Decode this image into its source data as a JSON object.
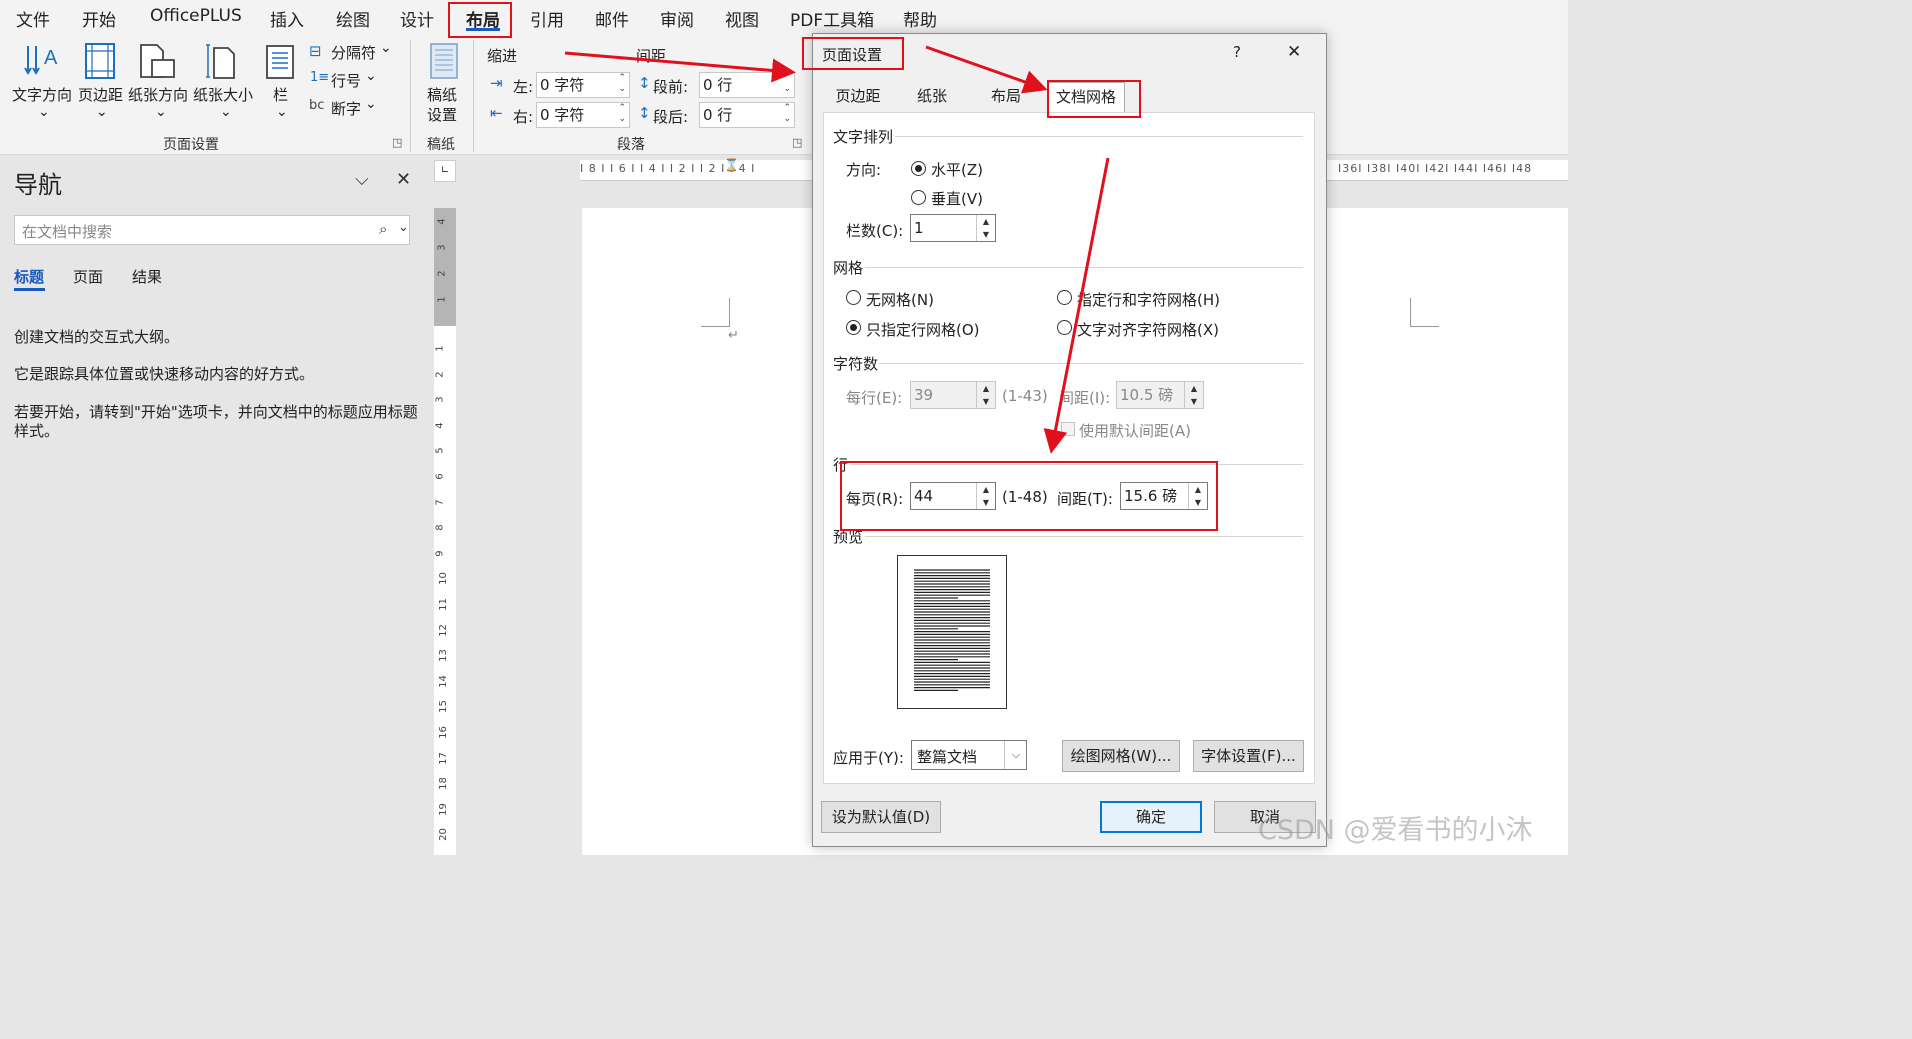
{
  "menubar": {
    "items": [
      "文件",
      "开始",
      "OfficePLUS",
      "插入",
      "绘图",
      "设计",
      "布局",
      "引用",
      "邮件",
      "审阅",
      "视图",
      "PDF工具箱",
      "帮助"
    ],
    "active": "布局"
  },
  "ribbon": {
    "page_setup": {
      "text_direction": "文字方向",
      "margins": "页边距",
      "orientation": "纸张方向",
      "size": "纸张大小",
      "columns": "栏",
      "breaks": "分隔符",
      "line_numbers": "行号",
      "hyphenation": "断字",
      "group_label": "页面设置"
    },
    "manuscript": {
      "button_line1": "稿纸",
      "button_line2": "设置",
      "group_label": "稿纸"
    },
    "paragraph": {
      "indent_header": "缩进",
      "spacing_header": "间距",
      "left_label": "左:",
      "left_value": "0 字符",
      "right_label": "右:",
      "right_value": "0 字符",
      "before_label": "段前:",
      "before_value": "0 行",
      "after_label": "段后:",
      "after_value": "0 行",
      "group_label": "段落"
    }
  },
  "nav": {
    "title": "导航",
    "search_placeholder": "在文档中搜索",
    "tabs": [
      "标题",
      "页面",
      "结果"
    ],
    "p1": "创建文档的交互式大纲。",
    "p2": "它是跟踪具体位置或快速移动内容的好方式。",
    "p3_line1": "若要开始，请转到\"开始\"选项卡，并向文档中的标题应用标题",
    "p3_line2": "样式。"
  },
  "ruler": {
    "h_left": "I 8 I  I 6 I  I 4 I  I 2 I     I 2 I  I 4 I",
    "h_right": "I36I  I38I  I40I  I42I  I44I  I46I  I48",
    "v_top": [
      "4",
      "3",
      "2",
      "1"
    ],
    "v_main": [
      "1",
      "2",
      "3",
      "4",
      "5",
      "6",
      "7",
      "8",
      "9",
      "10",
      "11",
      "12",
      "13",
      "14",
      "15",
      "16",
      "17",
      "18",
      "19",
      "20"
    ]
  },
  "dialog": {
    "title": "页面设置",
    "help": "?",
    "close": "✕",
    "tabs": [
      "页边距",
      "纸张",
      "布局",
      "文档网格"
    ],
    "selected_tab": "文档网格",
    "text_layout_header": "文字排列",
    "direction_label": "方向:",
    "dir_horizontal": "水平(Z)",
    "dir_vertical": "垂直(V)",
    "columns_label": "栏数(C):",
    "columns_value": "1",
    "grid_header": "网格",
    "grid_none": "无网格(N)",
    "grid_line_char": "指定行和字符网格(H)",
    "grid_line_only": "只指定行网格(O)",
    "grid_snap_char": "文字对齐字符网格(X)",
    "chars_header": "字符数",
    "per_line_label": "每行(E):",
    "per_line_value": "39",
    "per_line_range": "(1-43)",
    "char_pitch_label": "间距(I):",
    "char_pitch_value": "10.5 磅",
    "use_default_pitch": "使用默认间距(A)",
    "lines_header": "行",
    "per_page_label": "每页(R):",
    "per_page_value": "44",
    "per_page_range": "(1-48)",
    "line_pitch_label": "间距(T):",
    "line_pitch_value": "15.6 磅",
    "preview_header": "预览",
    "apply_label": "应用于(Y):",
    "apply_value": "整篇文档",
    "draw_grid_btn": "绘图网格(W)...",
    "font_settings_btn": "字体设置(F)...",
    "set_default_btn": "设为默认值(D)",
    "ok_btn": "确定",
    "cancel_btn": "取消"
  },
  "watermark": "CSDN @爱看书的小沐",
  "colors": {
    "annotation_red": "#e0101c",
    "accent_blue": "#185abd"
  }
}
